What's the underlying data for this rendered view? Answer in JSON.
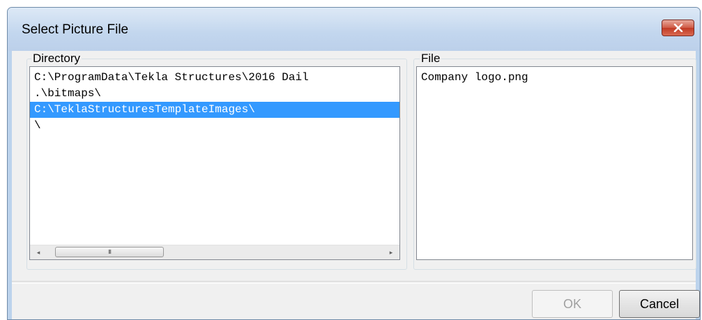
{
  "window": {
    "title": "Select Picture File",
    "close_icon": "close-x-icon"
  },
  "directory": {
    "label": "Directory",
    "items": [
      "C:\\ProgramData\\Tekla Structures\\2016 Dail",
      ".\\bitmaps\\",
      "C:\\TeklaStructuresTemplateImages\\",
      "\\"
    ],
    "selected_index": 2,
    "scroll": {
      "left_arrow": "◂",
      "right_arrow": "▸",
      "grip": "III"
    }
  },
  "file": {
    "label": "File",
    "items": [
      "Company logo.png"
    ]
  },
  "buttons": {
    "ok": "OK",
    "cancel": "Cancel"
  },
  "colors": {
    "selection": "#3399ff",
    "close_button": "#c13a24"
  }
}
